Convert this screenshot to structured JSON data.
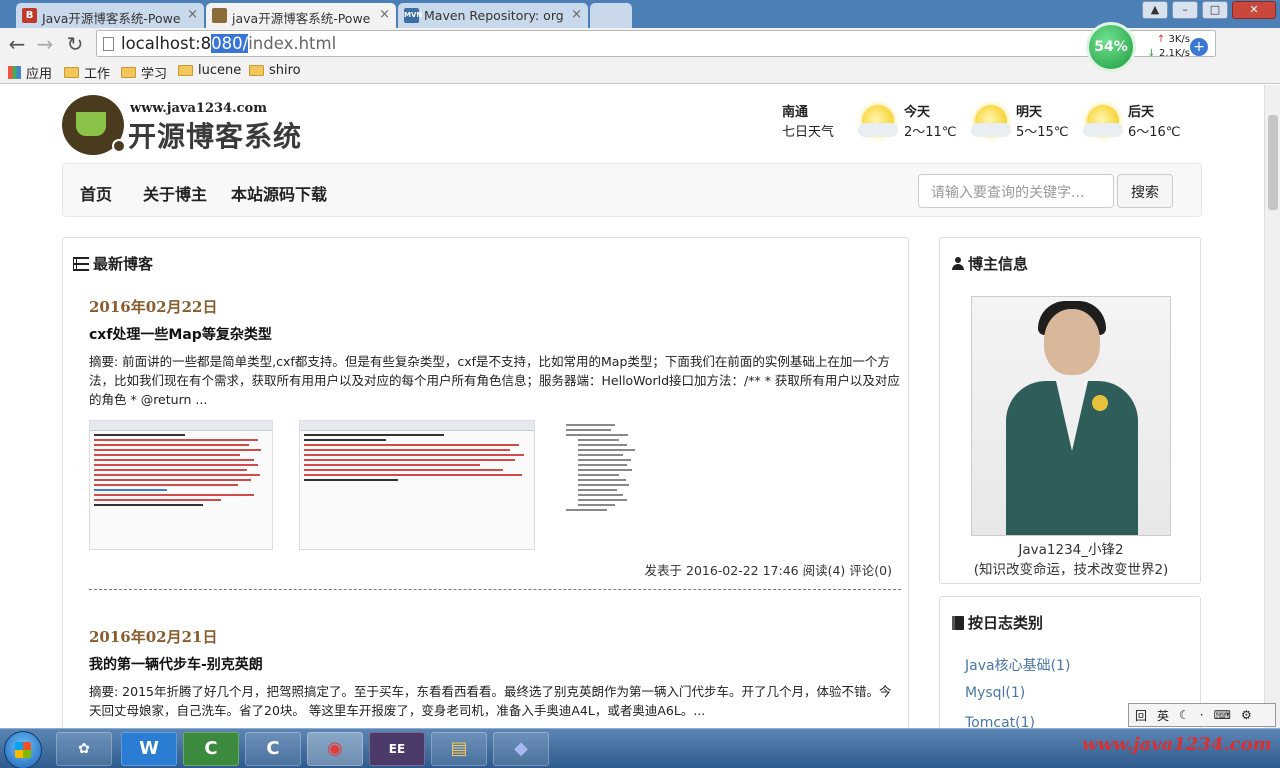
{
  "browser": {
    "tabs": [
      {
        "label": "Java开源博客系统-Powe",
        "favicon": "B",
        "favicon_color": "#c0392b",
        "active": false
      },
      {
        "label": "java开源博客系统-Powe",
        "favicon": "",
        "favicon_color": "#8a6d3b",
        "active": true
      },
      {
        "label": "Maven Repository: org",
        "favicon": "MVN",
        "favicon_color": "#3a6ea5",
        "active": false
      }
    ],
    "window_controls": {
      "minimize": "–",
      "maximize": "□",
      "close": "✕",
      "extra": "▲"
    },
    "address": {
      "host": "localhost:8",
      "selected": "080/",
      "path": "index.html"
    },
    "speed": {
      "percent": "54%",
      "up": "3K/s",
      "down": "2.1K/s"
    },
    "bookmarks": [
      {
        "label": "应用",
        "type": "apps"
      },
      {
        "label": "工作",
        "type": "folder"
      },
      {
        "label": "学习",
        "type": "folder"
      },
      {
        "label": "lucene",
        "type": "folder"
      },
      {
        "label": "shiro",
        "type": "folder"
      }
    ]
  },
  "site": {
    "logo_url": "www.java1234.com",
    "logo_title": "开源博客系统",
    "weather": {
      "city": "南通",
      "forecast_label": "七日天气",
      "days": [
        {
          "name": "今天",
          "temp": "2～11℃"
        },
        {
          "name": "明天",
          "temp": "5～15℃"
        },
        {
          "name": "后天",
          "temp": "6～16℃"
        }
      ]
    },
    "nav": {
      "links": [
        "首页",
        "关于博主",
        "本站源码下载"
      ],
      "search_placeholder": "请输入要查询的关键字...",
      "search_button": "搜索"
    }
  },
  "blog": {
    "title": "最新博客",
    "posts": [
      {
        "date": "2016年02月22日",
        "title": "cxf处理一些Map等复杂类型",
        "summary": "摘要: 前面讲的一些都是简单类型,cxf都支持。但是有些复杂类型，cxf是不支持，比如常用的Map类型；下面我们在前面的实例基础上在加一个方法，比如我们现在有个需求，获取所有用用户以及对应的每个用户所有角色信息；服务器端：HelloWorld接口加方法：/** * 获取所有用户以及对应的角色 * @return ...",
        "meta": "发表于 2016-02-22 17:46 阅读(4) 评论(0)"
      },
      {
        "date": "2016年02月21日",
        "title": "我的第一辆代步车-别克英朗",
        "summary": "摘要: 2015年折腾了好几个月，把驾照搞定了。至于买车，东看看西看看。最终选了别克英朗作为第一辆入门代步车。开了几个月，体验不错。今天回丈母娘家，自己洗车。省了20块。 等这里车开报废了，变身老司机，准备入手奥迪A4L，或者奥迪A6L。..."
      }
    ]
  },
  "author": {
    "title": "博主信息",
    "name": "Java1234_小锋2",
    "motto": "(知识改变命运，技术改变世界2)"
  },
  "categories": {
    "title": "按日志类别",
    "items": [
      "Java核心基础(1)",
      "Mysql(1)",
      "Tomcat(1)"
    ]
  },
  "taskbar": {
    "apps": [
      {
        "name": "wps-writer",
        "label": "W"
      },
      {
        "name": "camtasia-1",
        "label": "C"
      },
      {
        "name": "camtasia-2",
        "label": "C"
      },
      {
        "name": "chrome",
        "label": "◉"
      },
      {
        "name": "eclipse-jee",
        "label": "EE"
      },
      {
        "name": "explorer",
        "label": "▤"
      },
      {
        "name": "app-7",
        "label": "◆"
      }
    ],
    "ime": "英",
    "watermark": "www.java1234.com"
  },
  "colors": {
    "date": "#8a5c2d",
    "category_link": "#4a76a8",
    "tabstrip": "#4b7fb6"
  }
}
